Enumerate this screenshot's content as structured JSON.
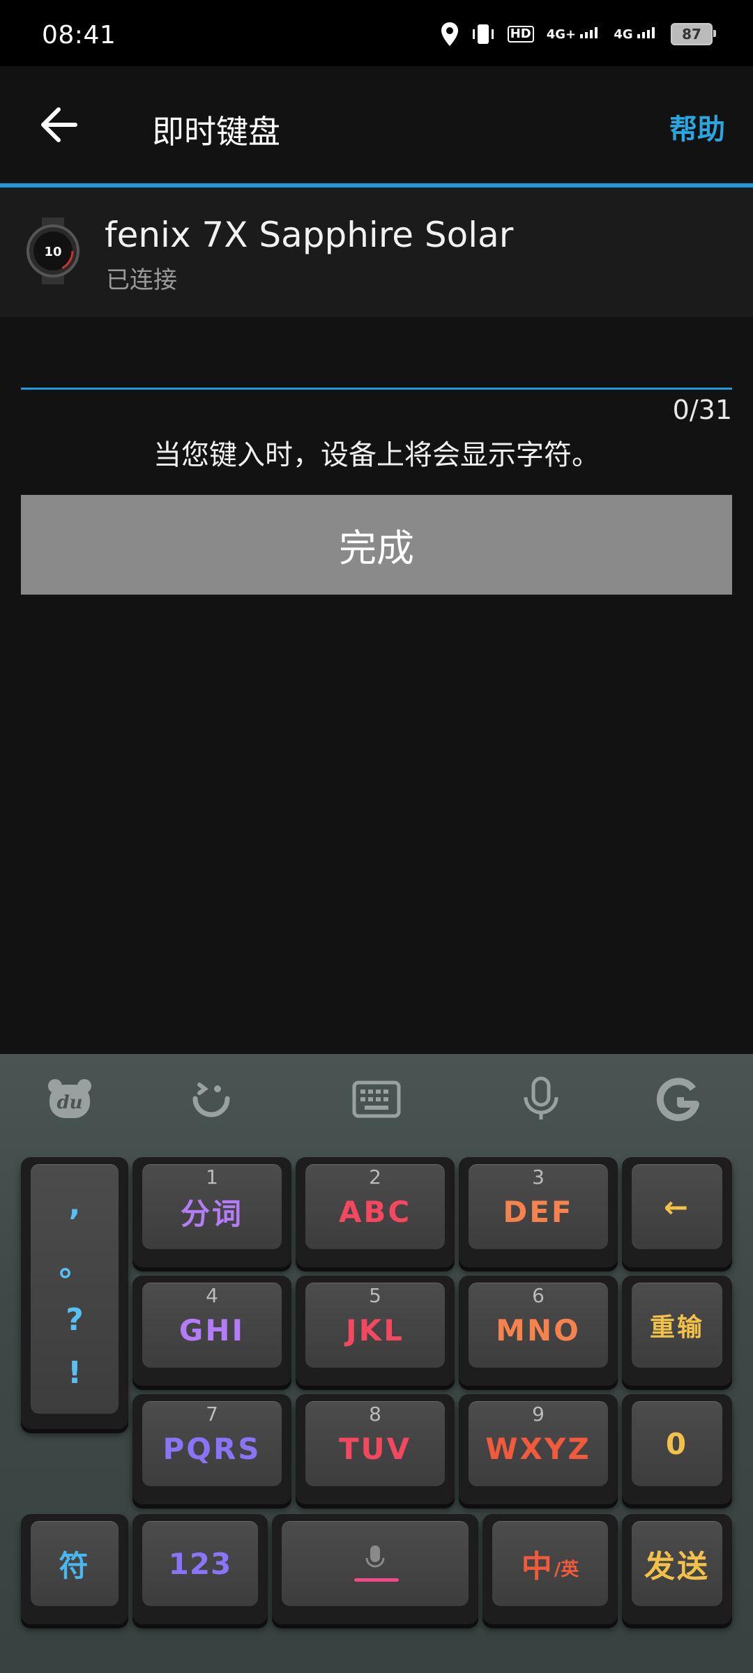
{
  "status_bar": {
    "time": "08:41",
    "hd_label": "HD",
    "net1": "4G+",
    "net2": "4G",
    "battery": "87"
  },
  "appbar": {
    "title": "即时键盘",
    "help": "帮助"
  },
  "device": {
    "name": "fenix 7X Sapphire Solar",
    "status": "已连接",
    "watch_face": "10"
  },
  "input": {
    "value": "",
    "placeholder": "",
    "count": "0/31"
  },
  "hint": "当您键入时，设备上将会显示字符。",
  "done_button": "完成",
  "keyboard": {
    "punct": [
      ",",
      "。",
      "?",
      "!"
    ],
    "keys": [
      {
        "num": "1",
        "label": "分词"
      },
      {
        "num": "2",
        "label": "ABC"
      },
      {
        "num": "3",
        "label": "DEF"
      },
      {
        "num": "4",
        "label": "GHI"
      },
      {
        "num": "5",
        "label": "JKL"
      },
      {
        "num": "6",
        "label": "MNO"
      },
      {
        "num": "7",
        "label": "PQRS"
      },
      {
        "num": "8",
        "label": "TUV"
      },
      {
        "num": "9",
        "label": "WXYZ"
      }
    ],
    "backspace": "←",
    "reenter": "重输",
    "zero": "0",
    "symbol": "符",
    "numeric": "123",
    "lang_main": "中",
    "lang_alt": "/英",
    "send": "发送",
    "toolbar": [
      "du-logo-icon",
      "emoji-icon",
      "keyboard-icon",
      "microphone-icon",
      "g-logo-icon"
    ]
  },
  "colors": {
    "accent": "#1e9bdc",
    "help": "#2aa7e0",
    "done": "#8a8a8a"
  }
}
